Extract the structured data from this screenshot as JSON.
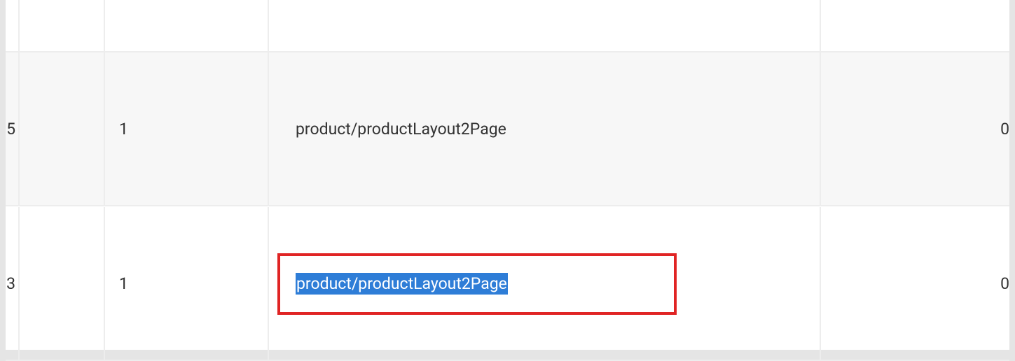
{
  "table": {
    "rows": [
      {
        "col_a": "",
        "col_b": "",
        "col_c": "",
        "col_d": "",
        "col_e": ""
      },
      {
        "col_a": "5",
        "col_b": "",
        "col_c": "1",
        "col_d": "product/productLayout2Page",
        "col_e": "0"
      },
      {
        "col_a": "3",
        "col_b": "",
        "col_c": "1",
        "col_d": "product/productLayout2Page",
        "col_e": "0"
      }
    ]
  },
  "highlight": {
    "row_index": 2,
    "column": "col_d"
  }
}
